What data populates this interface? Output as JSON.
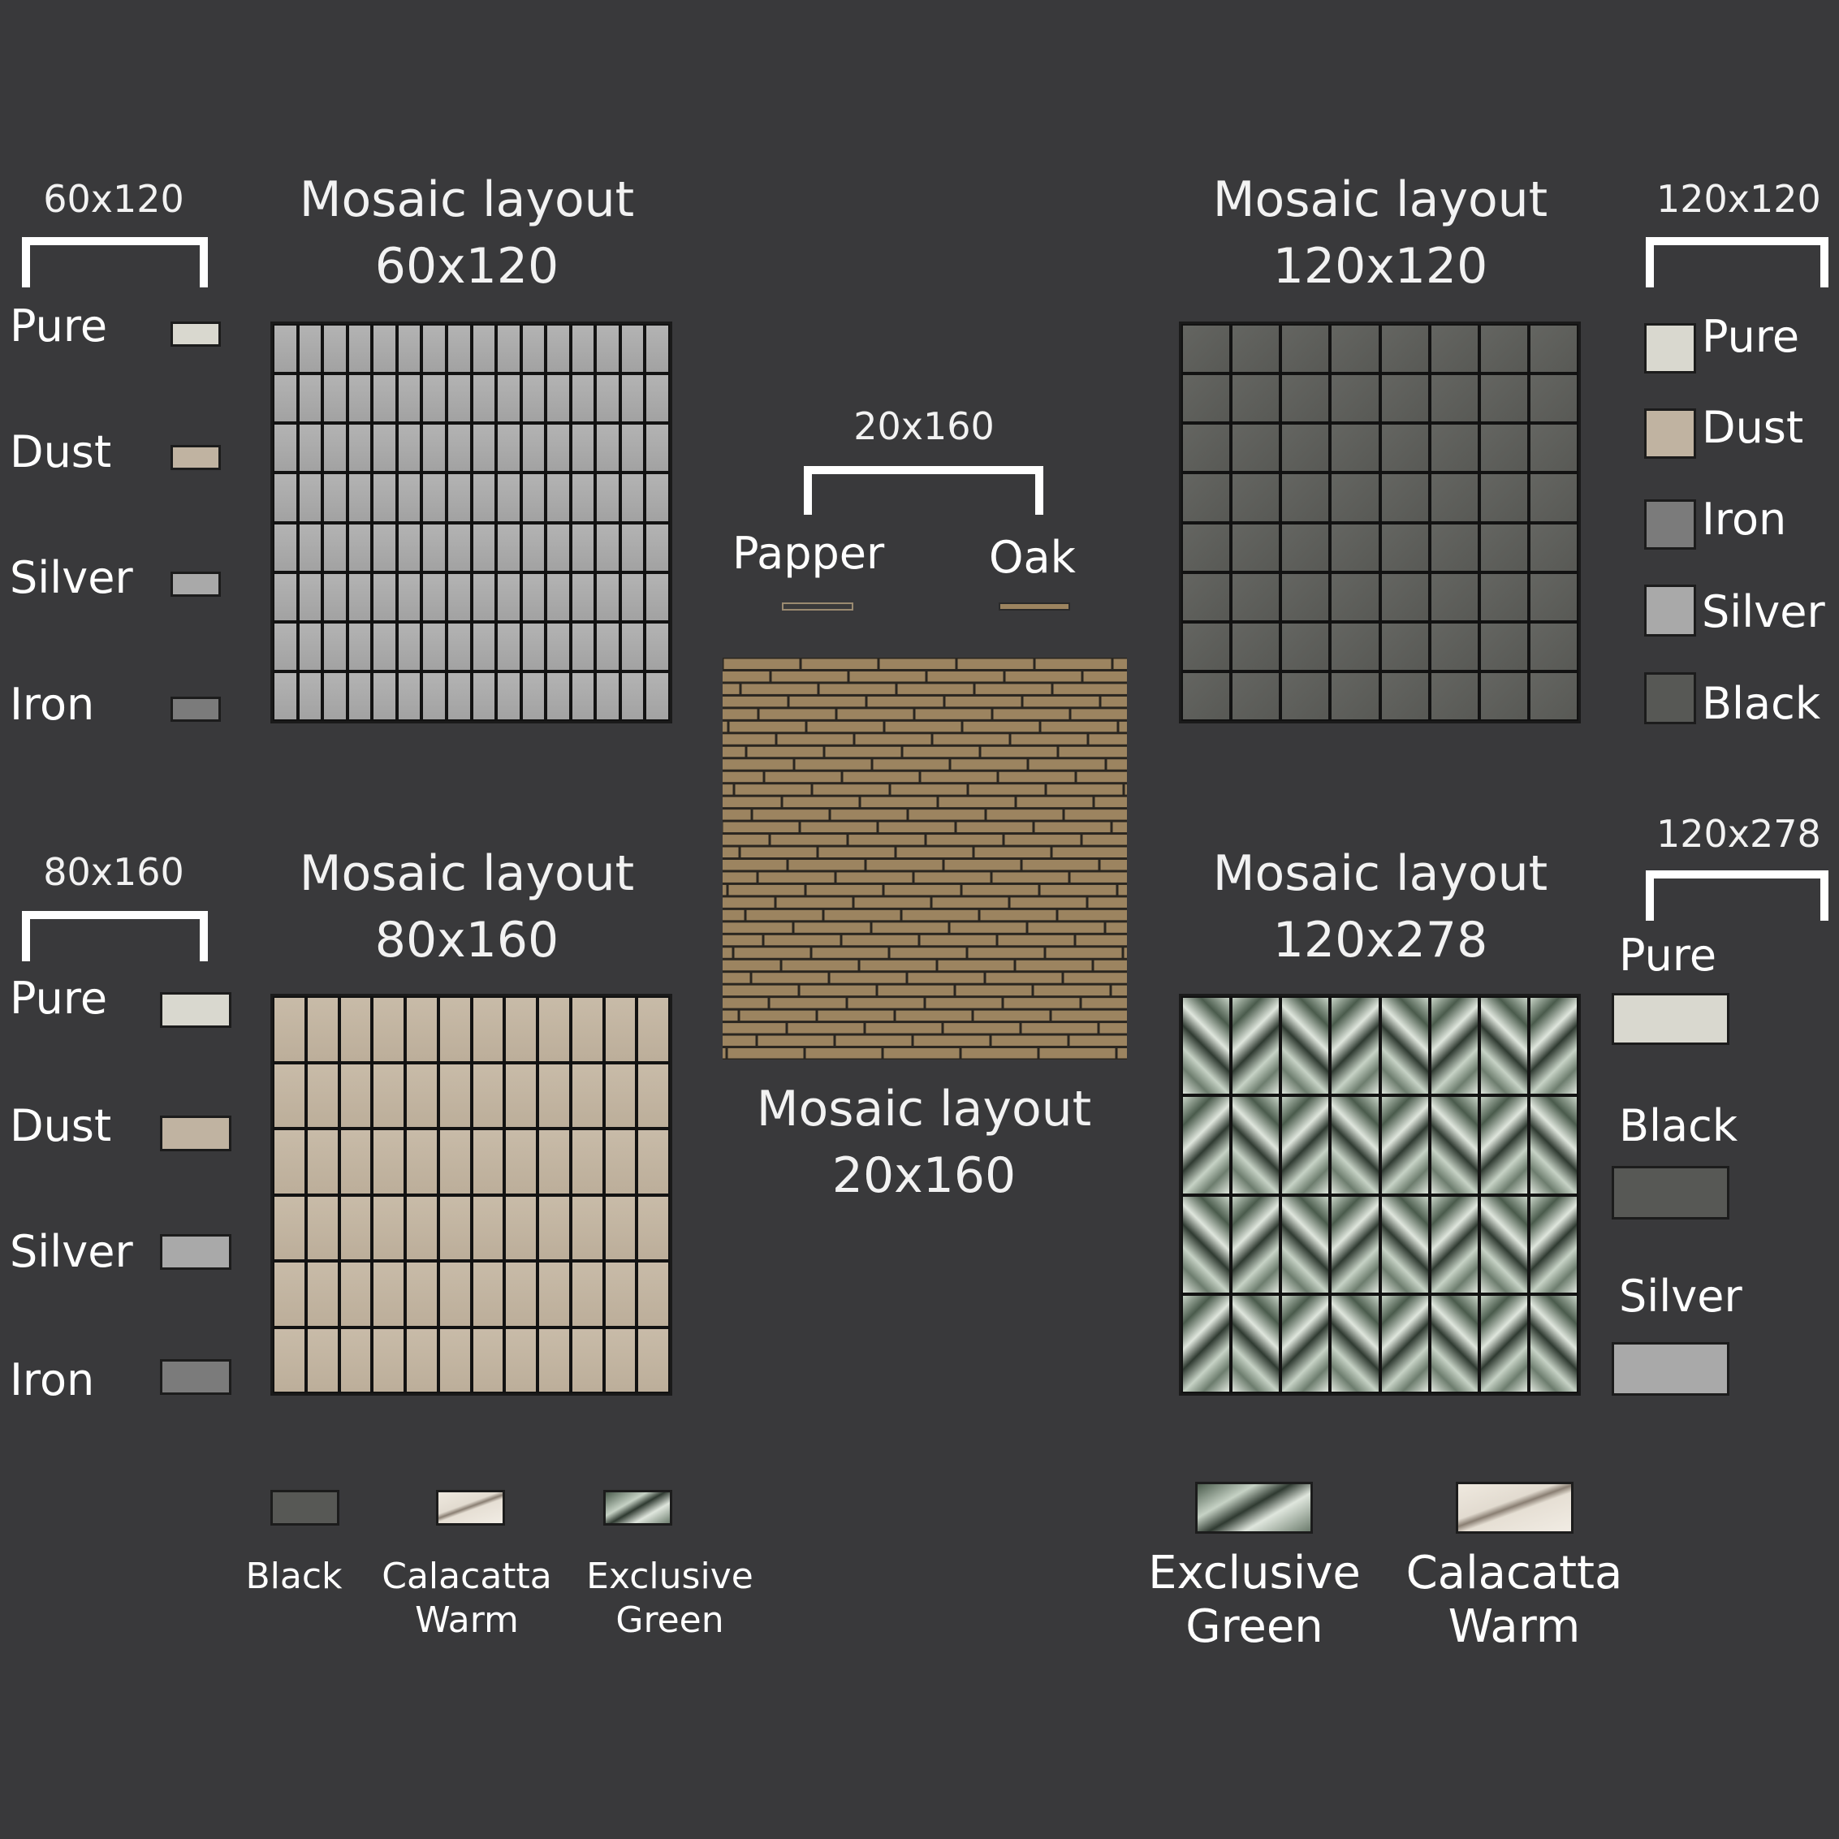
{
  "colors": {
    "background": "#39393b",
    "pure": "#d9d8cf",
    "dust": "#c0b3a1",
    "silver": "#a9a9a9",
    "iron": "#7b7b7b",
    "black": "#575855",
    "oak": "#9c8460",
    "papper": "#3a3a3a",
    "green_light": "#c6d2c5",
    "green_dark": "#4a5b4c",
    "calacatta": "#e2dbd0"
  },
  "panel_60x120": {
    "title_line1": "Mosaic layout",
    "title_line2": "60x120",
    "size_label": "60x120",
    "variants": [
      "Pure",
      "Dust",
      "Silver",
      "Iron"
    ],
    "grid_color": "#a8a8a8"
  },
  "panel_120x120": {
    "title_line1": "Mosaic layout",
    "title_line2": "120x120",
    "size_label": "120x120",
    "variants": [
      "Pure",
      "Dust",
      "Iron",
      "Silver",
      "Black"
    ],
    "grid_color": "#5f605c"
  },
  "panel_20x160": {
    "title_line1": "Mosaic layout",
    "title_line2": "20x160",
    "size_label": "20x160",
    "variants": [
      "Papper",
      "Oak"
    ]
  },
  "panel_80x160": {
    "title_line1": "Mosaic layout",
    "title_line2": "80x160",
    "size_label": "80x160",
    "variants": [
      "Pure",
      "Dust",
      "Silver",
      "Iron"
    ],
    "grid_color": "#c2b5a2"
  },
  "panel_120x278": {
    "title_line1": "Mosaic layout",
    "title_line2": "120x278",
    "size_label": "120x278",
    "variants": [
      "Pure",
      "Black",
      "Silver"
    ]
  },
  "bottom_left_swatches": [
    {
      "line1": "Black",
      "line2": ""
    },
    {
      "line1": "Calacatta",
      "line2": "Warm"
    },
    {
      "line1": "Exclusive",
      "line2": "Green"
    }
  ],
  "bottom_right_swatches": [
    {
      "line1": "Exclusive",
      "line2": "Green"
    },
    {
      "line1": "Calacatta",
      "line2": "Warm"
    }
  ]
}
